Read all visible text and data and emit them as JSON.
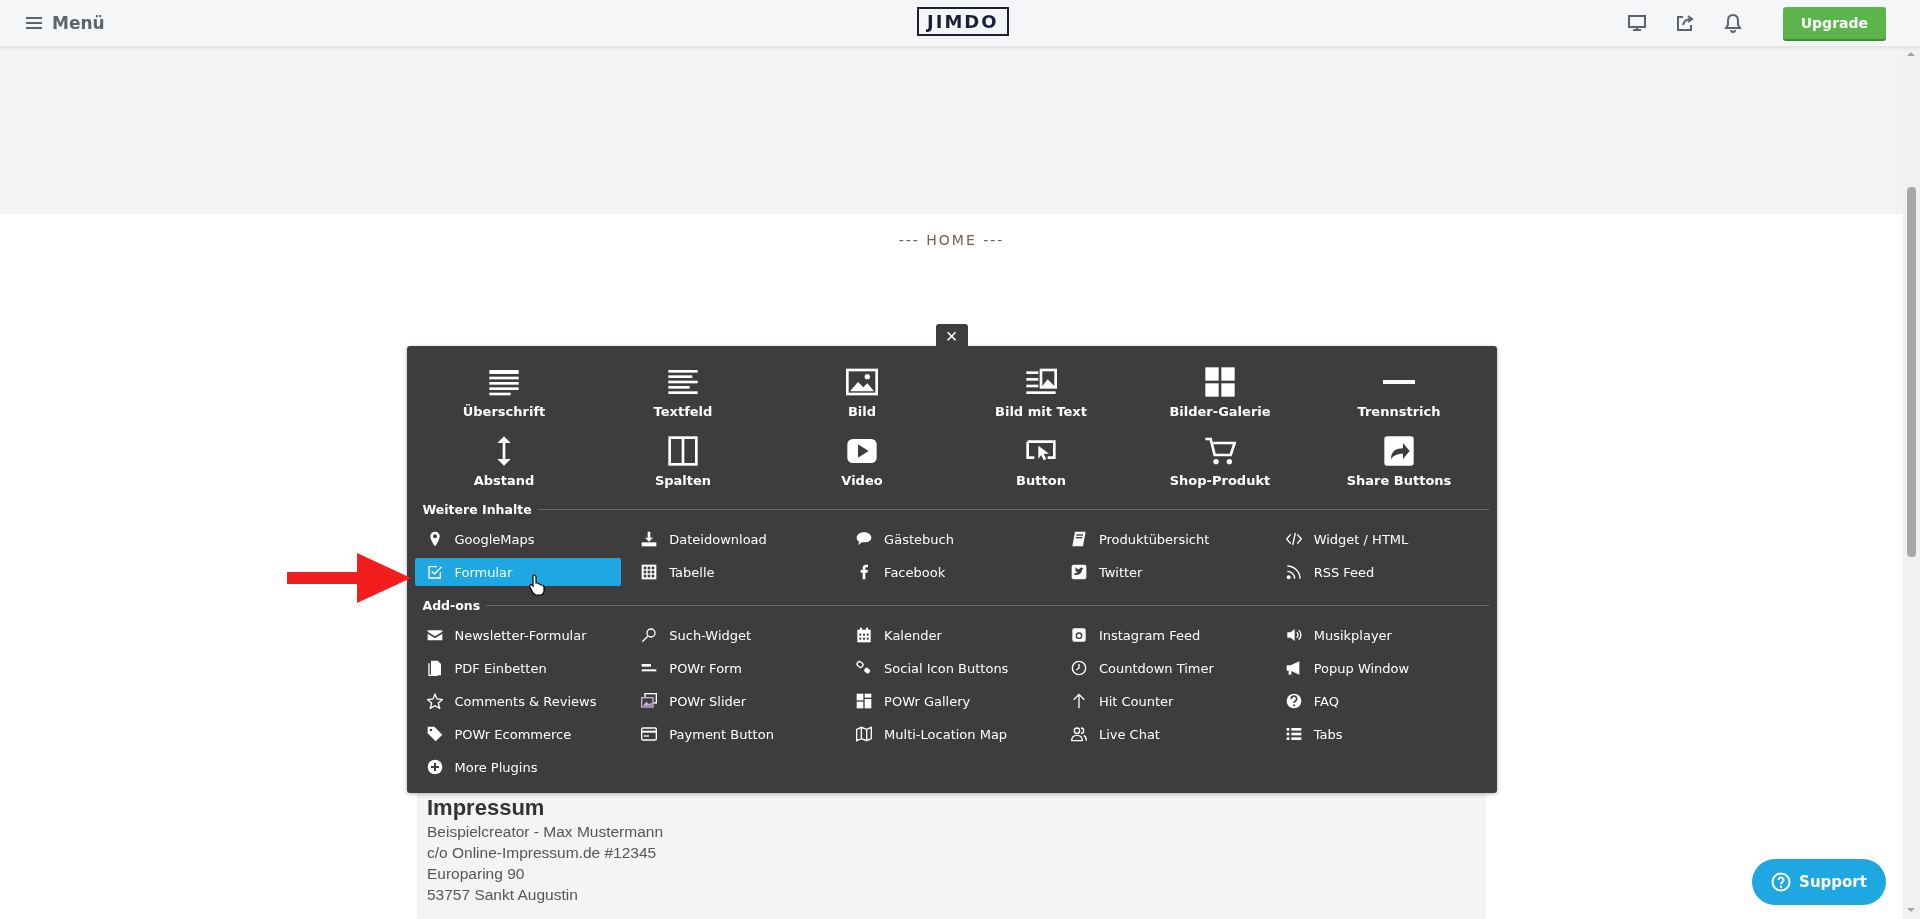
{
  "topbar": {
    "menu_label": "Menü",
    "logo": "JIMDO",
    "upgrade_label": "Upgrade"
  },
  "page": {
    "nav_title": "--- HOME ---"
  },
  "panel": {
    "close": "×",
    "tiles": [
      {
        "label": "Überschrift"
      },
      {
        "label": "Textfeld"
      },
      {
        "label": "Bild"
      },
      {
        "label": "Bild mit Text"
      },
      {
        "label": "Bilder-Galerie"
      },
      {
        "label": "Trennstrich"
      },
      {
        "label": "Abstand"
      },
      {
        "label": "Spalten"
      },
      {
        "label": "Video"
      },
      {
        "label": "Button"
      },
      {
        "label": "Shop-Produkt"
      },
      {
        "label": "Share Buttons"
      }
    ],
    "sections": [
      {
        "title": "Weitere Inhalte",
        "items": [
          {
            "label": "GoogleMaps",
            "selected": false
          },
          {
            "label": "Dateidownload",
            "selected": false
          },
          {
            "label": "Gästebuch",
            "selected": false
          },
          {
            "label": "Produktübersicht",
            "selected": false
          },
          {
            "label": "Widget / HTML",
            "selected": false
          },
          {
            "label": "Formular",
            "selected": true
          },
          {
            "label": "Tabelle",
            "selected": false
          },
          {
            "label": "Facebook",
            "selected": false
          },
          {
            "label": "Twitter",
            "selected": false
          },
          {
            "label": "RSS Feed",
            "selected": false
          }
        ]
      },
      {
        "title": "Add-ons",
        "items": [
          {
            "label": "Newsletter-Formular",
            "selected": false
          },
          {
            "label": "Such-Widget",
            "selected": false
          },
          {
            "label": "Kalender",
            "selected": false
          },
          {
            "label": "Instagram Feed",
            "selected": false
          },
          {
            "label": "Musikplayer",
            "selected": false
          },
          {
            "label": "PDF Einbetten",
            "selected": false
          },
          {
            "label": "POWr Form",
            "selected": false
          },
          {
            "label": "Social Icon Buttons",
            "selected": false
          },
          {
            "label": "Countdown Timer",
            "selected": false
          },
          {
            "label": "Popup Window",
            "selected": false
          },
          {
            "label": "Comments & Reviews",
            "selected": false
          },
          {
            "label": "POWr Slider",
            "selected": false
          },
          {
            "label": "POWr Gallery",
            "selected": false
          },
          {
            "label": "Hit Counter",
            "selected": false
          },
          {
            "label": "FAQ",
            "selected": false
          },
          {
            "label": "POWr Ecommerce",
            "selected": false
          },
          {
            "label": "Payment Button",
            "selected": false
          },
          {
            "label": "Multi-Location Map",
            "selected": false
          },
          {
            "label": "Live Chat",
            "selected": false
          },
          {
            "label": "Tabs",
            "selected": false
          },
          {
            "label": "More Plugins",
            "selected": false
          }
        ]
      }
    ]
  },
  "impressum": {
    "title": "Impressum",
    "lines": [
      "Beispielcreator - Max Mustermann",
      "c/o Online-Impressum.de #12345",
      "Europaring 90",
      "53757 Sankt Augustin"
    ]
  },
  "support": {
    "label": "Support"
  }
}
